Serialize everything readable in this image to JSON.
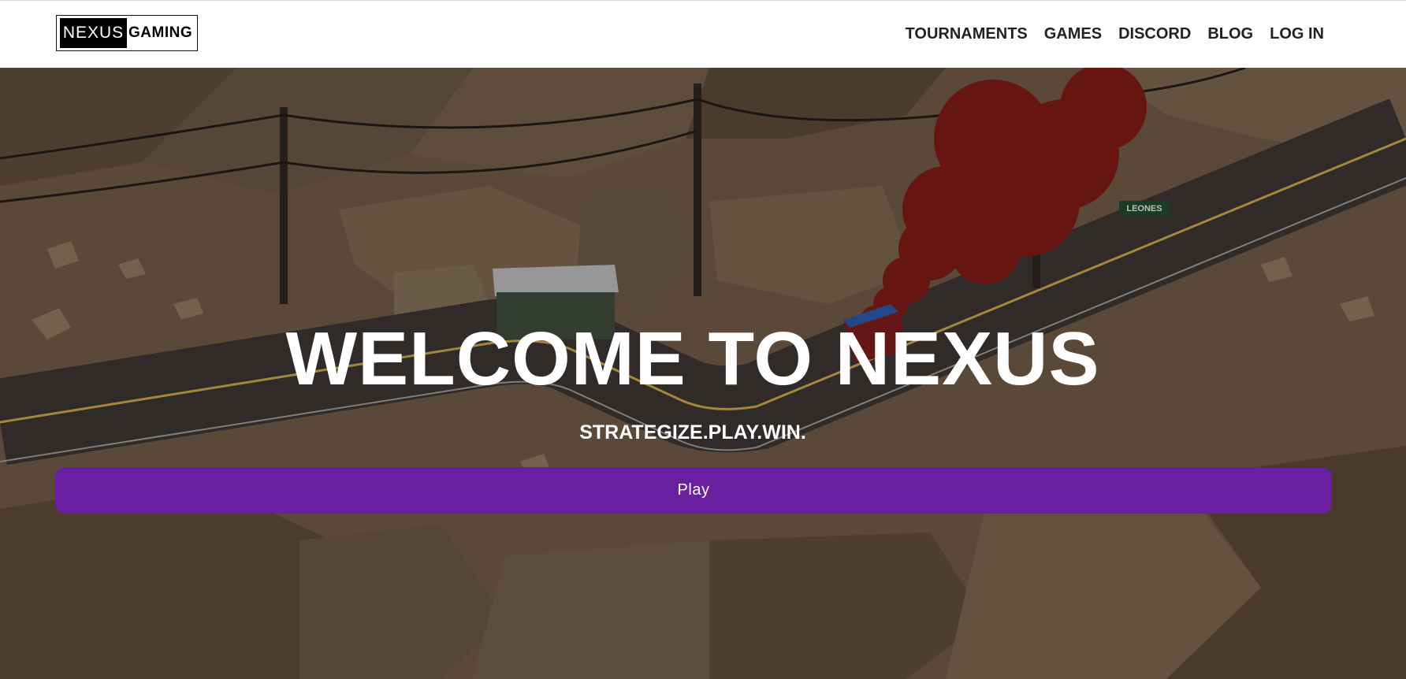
{
  "brand": {
    "logo_boxed": "NEXUS",
    "logo_text": "GAMING"
  },
  "nav": {
    "items": [
      {
        "label": "TOURNAMENTS"
      },
      {
        "label": "GAMES"
      },
      {
        "label": "DISCORD"
      },
      {
        "label": "BLOG"
      },
      {
        "label": "LOG IN"
      }
    ]
  },
  "hero": {
    "title": "WELCOME TO NEXUS",
    "subtitle": "STRATEGIZE.PLAY.WIN.",
    "play_label": "Play",
    "background_sign": "LEONES"
  },
  "colors": {
    "accent": "#6a1fa1",
    "header_bg": "#ffffff",
    "hero_tint": "#6f5a45"
  }
}
